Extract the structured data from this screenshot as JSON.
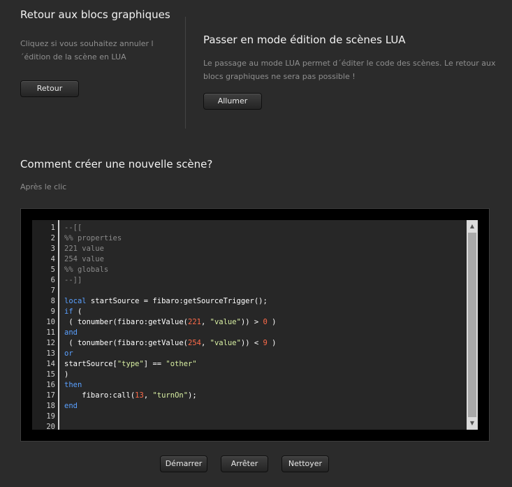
{
  "left_panel": {
    "title": "Retour aux blocs graphiques",
    "description": "Cliquez si vous souhaitez annuler l´édition de la scène en LUA",
    "button_label": "Retour"
  },
  "right_panel": {
    "title": "Passer en mode édition de scènes LUA",
    "description": "Le passage au mode LUA permet d´éditer le code des scènes. Le retour aux blocs graphiques ne sera pas possible !",
    "button_label": "Allumer"
  },
  "section": {
    "title": "Comment créer une nouvelle scène?",
    "subtitle": "Après le clic"
  },
  "editor": {
    "line_numbers": [
      "1",
      "2",
      "3",
      "4",
      "5",
      "6",
      "7",
      "8",
      "9",
      "10",
      "11",
      "12",
      "13",
      "14",
      "15",
      "16",
      "17",
      "18",
      "19",
      "20"
    ],
    "lines": [
      "--[[",
      "%% properties",
      "221 value",
      "254 value",
      "%% globals",
      "--]]",
      "",
      "local startSource = fibaro:getSourceTrigger();",
      "if (",
      " ( tonumber(fibaro:getValue(221, \"value\")) > 0 )",
      "and",
      " ( tonumber(fibaro:getValue(254, \"value\")) < 9 )",
      "or",
      "startSource[\"type\"] == \"other\"",
      ")",
      "then",
      "    fibaro:call(13, \"turnOn\");",
      "end",
      "",
      ""
    ]
  },
  "footer": {
    "start_label": "Démarrer",
    "stop_label": "Arrêter",
    "clear_label": "Nettoyer"
  },
  "colors": {
    "background": "#2b2b2b",
    "keyword": "#5aa0ff",
    "number": "#ff6b4a",
    "string": "#d9f0a3",
    "comment": "#8a8a8a"
  }
}
